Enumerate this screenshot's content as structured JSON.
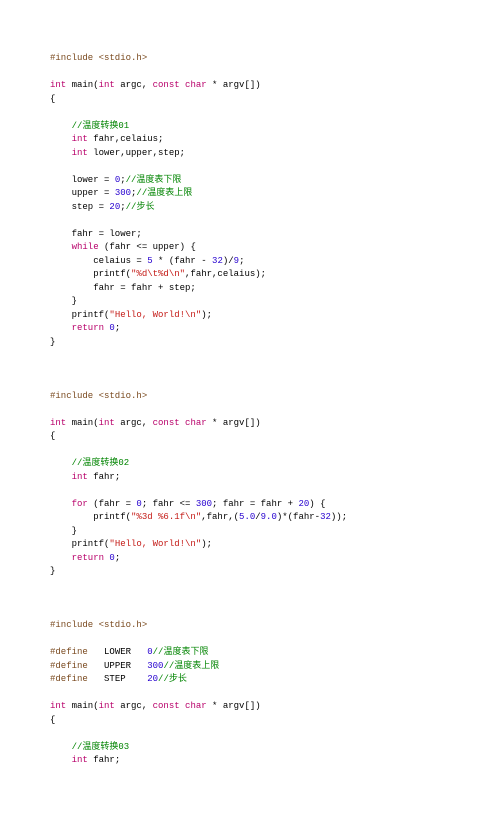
{
  "block1": {
    "inc": "#include ",
    "hdr": "<stdio.h>",
    "sig1": "int",
    "sig2": " main(",
    "sig3": "int",
    "sig4": " argc, ",
    "sig5": "const",
    "sig6": " ",
    "sig7": "char",
    "sig8": " * argv[])",
    "ob": "{",
    "c1": "//温度转换01",
    "l1a": "int",
    "l1b": " fahr,celaius;",
    "l2a": "int",
    "l2b": " lower,upper,step;",
    "l3a": "    lower = ",
    "l3n": "0",
    "l3b": ";",
    "l3c": "//温度表下限",
    "l4a": "    upper = ",
    "l4n": "300",
    "l4b": ";",
    "l4c": "//温度表上限",
    "l5a": "    step = ",
    "l5n": "20",
    "l5b": ";",
    "l5c": "//步长",
    "l6": "    fahr = lower;",
    "l7a": "while",
    "l7b": " (fahr <= upper) {",
    "l8a": "        celaius = ",
    "l8n1": "5",
    "l8b": " * (fahr - ",
    "l8n2": "32",
    "l8c": ")/",
    "l8n3": "9",
    "l8d": ";",
    "l9a": "        printf(",
    "l9s": "\"%d\\t%d\\n\"",
    "l9b": ",fahr,celaius);",
    "l10": "        fahr = fahr + step;",
    "l11": "    }",
    "l12a": "    printf(",
    "l12s": "\"Hello, World!\\n\"",
    "l12b": ");",
    "l13a": "return",
    "l13b": " ",
    "l13n": "0",
    "l13c": ";",
    "cb": "}"
  },
  "block2": {
    "inc": "#include ",
    "hdr": "<stdio.h>",
    "sig1": "int",
    "sig2": " main(",
    "sig3": "int",
    "sig4": " argc, ",
    "sig5": "const",
    "sig6": " ",
    "sig7": "char",
    "sig8": " * argv[])",
    "ob": "{",
    "c1": "//温度转换02",
    "l1a": "int",
    "l1b": " fahr;",
    "l2a": "for",
    "l2b": " (fahr = ",
    "l2n1": "0",
    "l2c": "; fahr <= ",
    "l2n2": "300",
    "l2d": "; fahr = fahr + ",
    "l2n3": "20",
    "l2e": ") {",
    "l3a": "        printf(",
    "l3s": "\"%3d %6.1f\\n\"",
    "l3b": ",fahr,(",
    "l3n1": "5.0",
    "l3c": "/",
    "l3n2": "9.0",
    "l3d": ")*(fahr-",
    "l3n3": "32",
    "l3e": "));",
    "l4": "    }",
    "l5a": "    printf(",
    "l5s": "\"Hello, World!\\n\"",
    "l5b": ");",
    "l6a": "return",
    "l6b": " ",
    "l6n": "0",
    "l6c": ";",
    "cb": "}"
  },
  "block3": {
    "inc": "#include ",
    "hdr": "<stdio.h>",
    "d1a": "#define",
    "d1b": "   LOWER   ",
    "d1n": "0",
    "d1c": "//温度表下限",
    "d2a": "#define",
    "d2b": "   UPPER   ",
    "d2n": "300",
    "d2c": "//温度表上限",
    "d3a": "#define",
    "d3b": "   STEP    ",
    "d3n": "20",
    "d3c": "//步长",
    "sig1": "int",
    "sig2": " main(",
    "sig3": "int",
    "sig4": " argc, ",
    "sig5": "const",
    "sig6": " ",
    "sig7": "char",
    "sig8": " * argv[])",
    "ob": "{",
    "c1": "//温度转换03",
    "l1a": "int",
    "l1b": " fahr;"
  }
}
